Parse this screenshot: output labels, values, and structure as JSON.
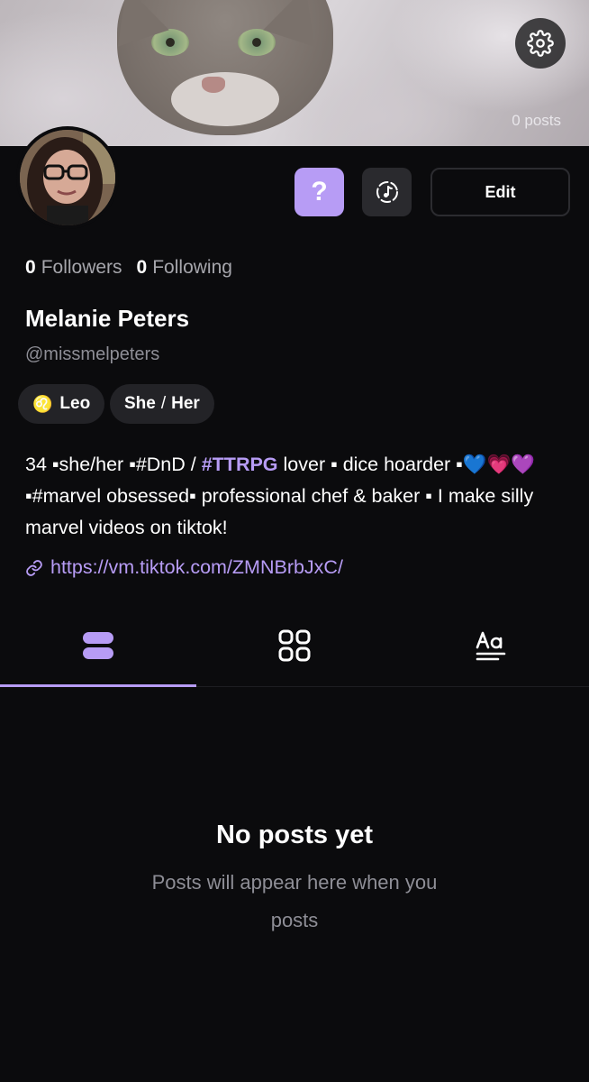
{
  "cover": {
    "posts_count": "0 posts"
  },
  "actions": {
    "question_label": "?",
    "edit_label": "Edit"
  },
  "stats": {
    "followers_count": "0",
    "followers_label": "Followers",
    "following_count": "0",
    "following_label": "Following"
  },
  "profile": {
    "name": "Melanie Peters",
    "handle": "@missmelpeters",
    "zodiac_symbol": "♌",
    "zodiac": "Leo",
    "pronoun_1": "She",
    "pronoun_sep": "/",
    "pronoun_2": "Her"
  },
  "bio": {
    "part1": "34 ▪she/her ▪#DnD / ",
    "hashtag": "#TTRPG",
    "part2": " lover ▪ dice hoarder  ▪💙💗💜 ▪#marvel obsessed▪ professional chef & baker ▪ I make silly marvel videos on tiktok!"
  },
  "link": {
    "url": "https://vm.tiktok.com/ZMNBrbJxC/"
  },
  "tabs": [
    {
      "name": "posts-list",
      "icon": "list-icon",
      "active": true
    },
    {
      "name": "grid",
      "icon": "grid-icon",
      "active": false
    },
    {
      "name": "text",
      "icon": "text-format-icon",
      "active": false
    }
  ],
  "empty_state": {
    "title": "No posts yet",
    "subtitle": "Posts will appear here when you posts"
  },
  "colors": {
    "accent": "#b79cf5",
    "background": "#0b0b0d",
    "muted": "#8e8e96"
  }
}
